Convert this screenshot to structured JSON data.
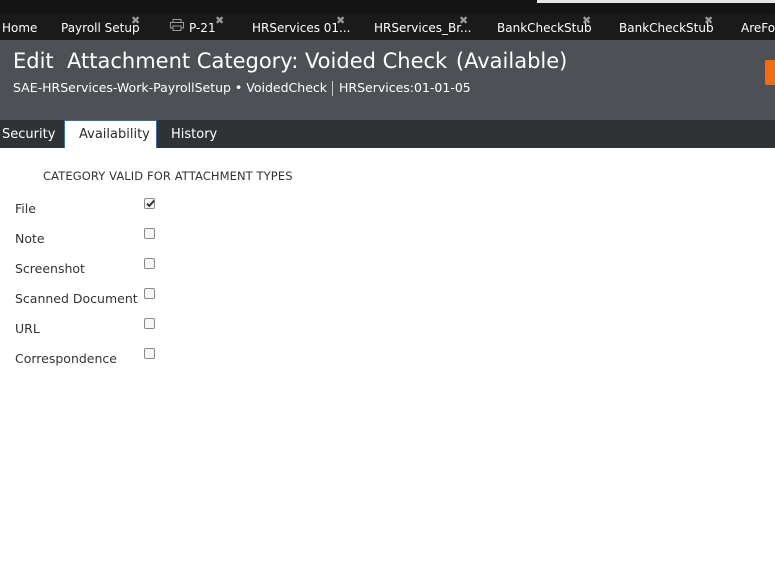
{
  "top_tabs": [
    {
      "label": "Home",
      "closable": false,
      "icon": null
    },
    {
      "label": "Payroll Setup",
      "closable": true,
      "icon": null
    },
    {
      "label": "P-21",
      "closable": true,
      "icon": "print-icon"
    },
    {
      "label": "HRServices 01...",
      "closable": true,
      "icon": null
    },
    {
      "label": "HRServices_Br...",
      "closable": true,
      "icon": null
    },
    {
      "label": "BankCheckStub",
      "closable": true,
      "icon": null
    },
    {
      "label": "BankCheckStub",
      "closable": true,
      "icon": null
    },
    {
      "label": "AreFor",
      "closable": false,
      "icon": null
    }
  ],
  "header": {
    "title": "Edit  Attachment Category: Voided Check",
    "status": "(Available)",
    "class_path": "SAE-HRServices-Work-PayrollSetup • VoidedCheck",
    "ruleset": "HRServices:01-01-05",
    "accent_color": "#f26c16"
  },
  "subtabs": [
    {
      "label": "Security",
      "active": false
    },
    {
      "label": "Availability",
      "active": true
    },
    {
      "label": "History",
      "active": false
    }
  ],
  "form": {
    "section_title": "CATEGORY VALID FOR ATTACHMENT TYPES",
    "types": [
      {
        "label": "File",
        "checked": true
      },
      {
        "label": "Note",
        "checked": false
      },
      {
        "label": "Screenshot",
        "checked": false
      },
      {
        "label": "Scanned Document",
        "checked": false
      },
      {
        "label": "URL",
        "checked": false
      },
      {
        "label": "Correspondence",
        "checked": false
      }
    ]
  }
}
